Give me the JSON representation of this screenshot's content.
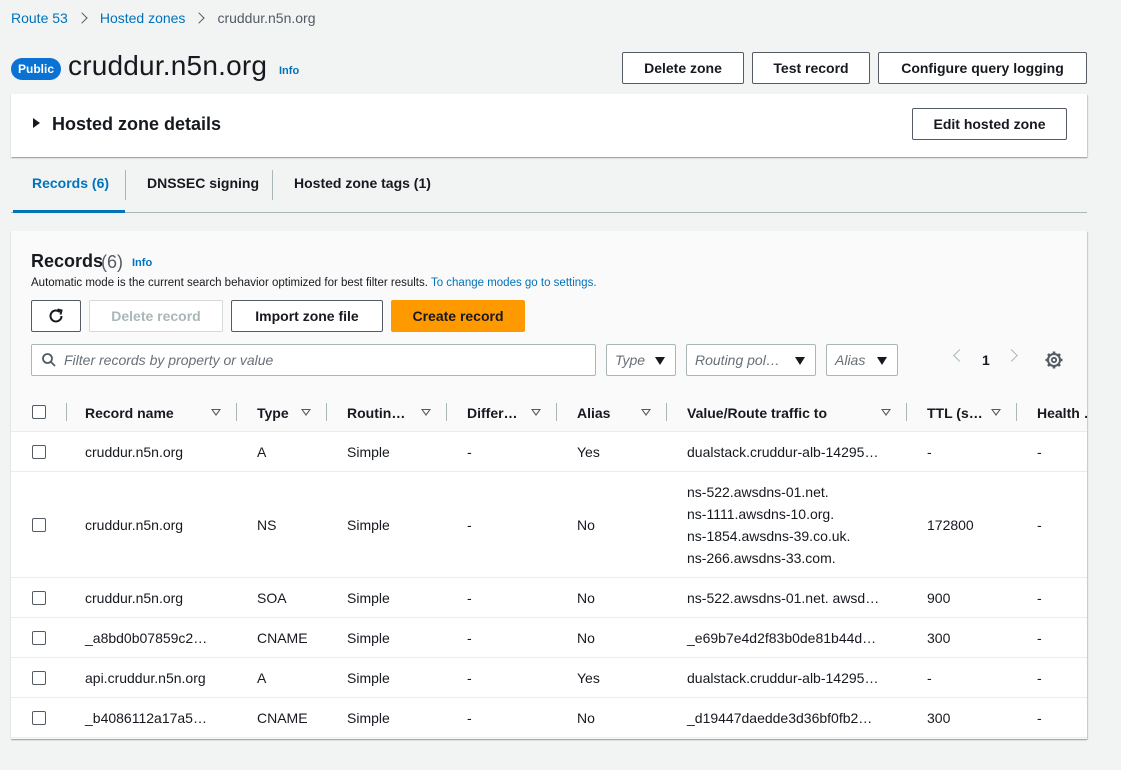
{
  "breadcrumb": {
    "items": [
      "Route 53",
      "Hosted zones"
    ],
    "current": "cruddur.n5n.org"
  },
  "header": {
    "badge": "Public",
    "title": "cruddur.n5n.org",
    "info": "Info",
    "buttons": {
      "delete_zone": "Delete zone",
      "test_record": "Test record",
      "configure_logging": "Configure query logging"
    }
  },
  "details": {
    "title": "Hosted zone details",
    "edit_button": "Edit hosted zone"
  },
  "tabs": [
    {
      "label": "Records (6)",
      "active": true
    },
    {
      "label": "DNSSEC signing",
      "active": false
    },
    {
      "label": "Hosted zone tags (1)",
      "active": false
    }
  ],
  "records": {
    "title": "Records",
    "count": "(6)",
    "info": "Info",
    "description": "Automatic mode is the current search behavior optimized for best filter results.",
    "description_link": "To change modes go to settings.",
    "buttons": {
      "delete": "Delete record",
      "import": "Import zone file",
      "create": "Create record"
    },
    "search_placeholder": "Filter records by property or value",
    "filters": {
      "type": "Type",
      "routing": "Routing pol…",
      "alias": "Alias"
    },
    "page": "1",
    "columns": [
      "Record name",
      "Type",
      "Routin…",
      "Differ…",
      "Alias",
      "Value/Route traffic to",
      "TTL (s…",
      "Health …"
    ],
    "rows": [
      {
        "name": "cruddur.n5n.org",
        "type": "A",
        "routing": "Simple",
        "differ": "-",
        "alias": "Yes",
        "value": "dualstack.cruddur-alb-14295…",
        "ttl": "-",
        "health": "-"
      },
      {
        "name": "cruddur.n5n.org",
        "type": "NS",
        "routing": "Simple",
        "differ": "-",
        "alias": "No",
        "value1": "ns-522.awsdns-01.net.",
        "value2": "ns-1111.awsdns-10.org.",
        "value3": "ns-1854.awsdns-39.co.uk.",
        "value4": "ns-266.awsdns-33.com.",
        "ttl": "172800",
        "health": "-"
      },
      {
        "name": "cruddur.n5n.org",
        "type": "SOA",
        "routing": "Simple",
        "differ": "-",
        "alias": "No",
        "value": "ns-522.awsdns-01.net. awsd…",
        "ttl": "900",
        "health": "-"
      },
      {
        "name": "_a8bd0b07859c2…",
        "type": "CNAME",
        "routing": "Simple",
        "differ": "-",
        "alias": "No",
        "value": "_e69b7e4d2f83b0de81b44d…",
        "ttl": "300",
        "health": "-"
      },
      {
        "name": "api.cruddur.n5n.org",
        "type": "A",
        "routing": "Simple",
        "differ": "-",
        "alias": "Yes",
        "value": "dualstack.cruddur-alb-14295…",
        "ttl": "-",
        "health": "-"
      },
      {
        "name": "_b4086112a17a5…",
        "type": "CNAME",
        "routing": "Simple",
        "differ": "-",
        "alias": "No",
        "value": "_d19447daedde3d36bf0fb2…",
        "ttl": "300",
        "health": "-"
      }
    ]
  },
  "colors": {
    "link": "#0073bb",
    "primary_button": "#ff9900",
    "badge": "#0972d3"
  }
}
